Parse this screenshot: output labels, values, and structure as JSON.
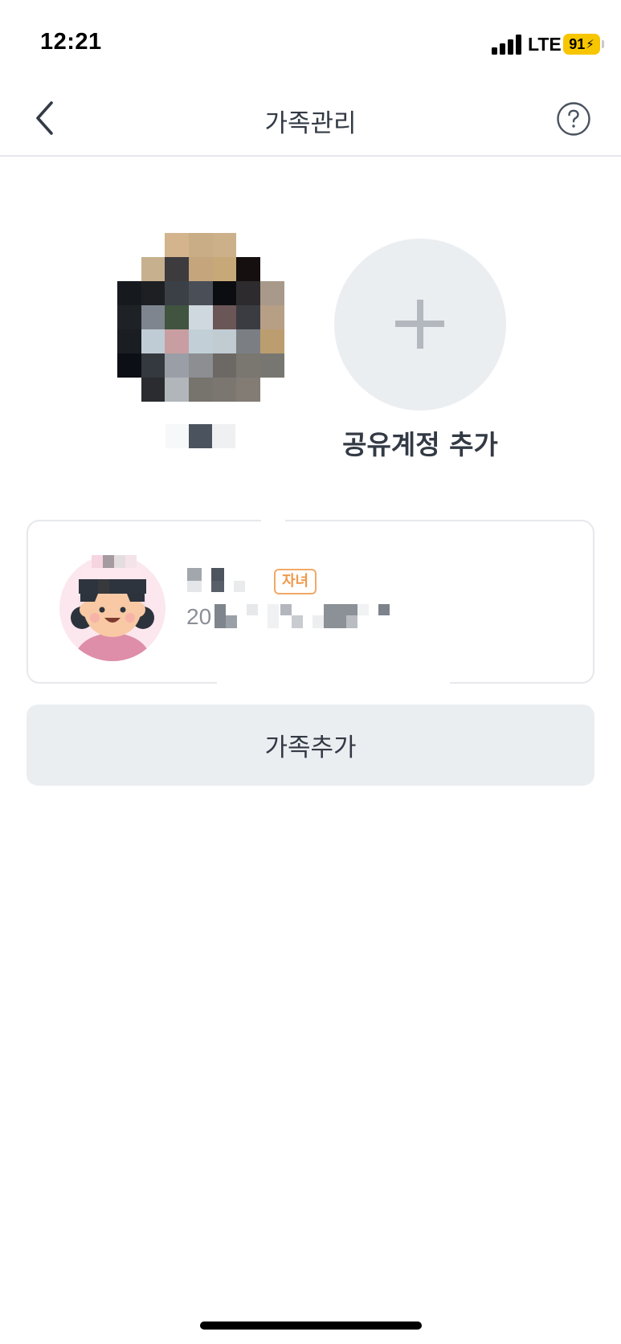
{
  "status_bar": {
    "time": "12:21",
    "network": "LTE",
    "battery": "91",
    "battery_color": "#f7c600",
    "icons": [
      "signal-icon",
      "battery-icon",
      "bolt-icon"
    ]
  },
  "header": {
    "title": "가족관리",
    "back_icon": "chevron-left-icon",
    "help_icon": "question-circle-icon"
  },
  "profile": {
    "avatar": "pixelated-profile-photo",
    "name_obscured": true
  },
  "add_shared_account": {
    "label": "공유계정 추가",
    "icon": "plus-icon"
  },
  "members": [
    {
      "avatar": "child-girl-avatar",
      "name_obscured": true,
      "role": "자녀",
      "birth_prefix": "20"
    }
  ],
  "add_family_button": {
    "label": "가족추가"
  },
  "colors": {
    "text_dark": "#333a45",
    "text_gray": "#8b9097",
    "button_bg": "#ebeef1",
    "border": "#e6e8eb",
    "badge_orange": "#f0994b"
  }
}
